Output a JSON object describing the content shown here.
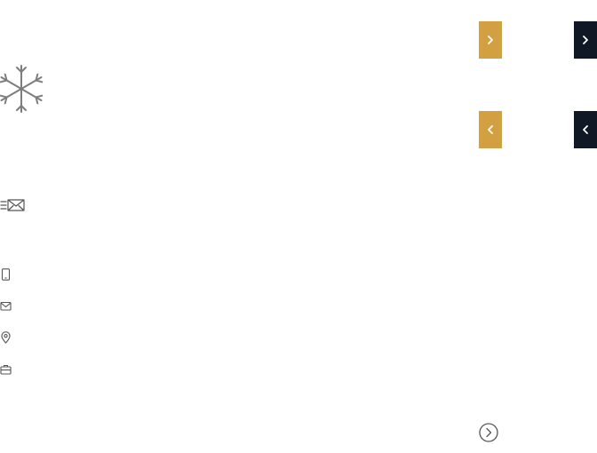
{
  "icons": {
    "decor": "snowflake-icon",
    "newsletter": "newsletter-envelope-icon",
    "contact": [
      "mobile-phone-icon",
      "mail-icon",
      "map-pin-icon",
      "briefcase-icon"
    ]
  },
  "nav": {
    "gold_next": "chevron-right-icon",
    "dark_next": "chevron-right-icon",
    "gold_prev": "chevron-left-icon",
    "dark_prev": "chevron-left-icon",
    "circle_next": "circle-chevron-right-icon"
  },
  "colors": {
    "gold": "#d2a040",
    "dark": "#0f1824",
    "icon_gray": "#7d7d7d",
    "icon_dark": "#555555"
  }
}
